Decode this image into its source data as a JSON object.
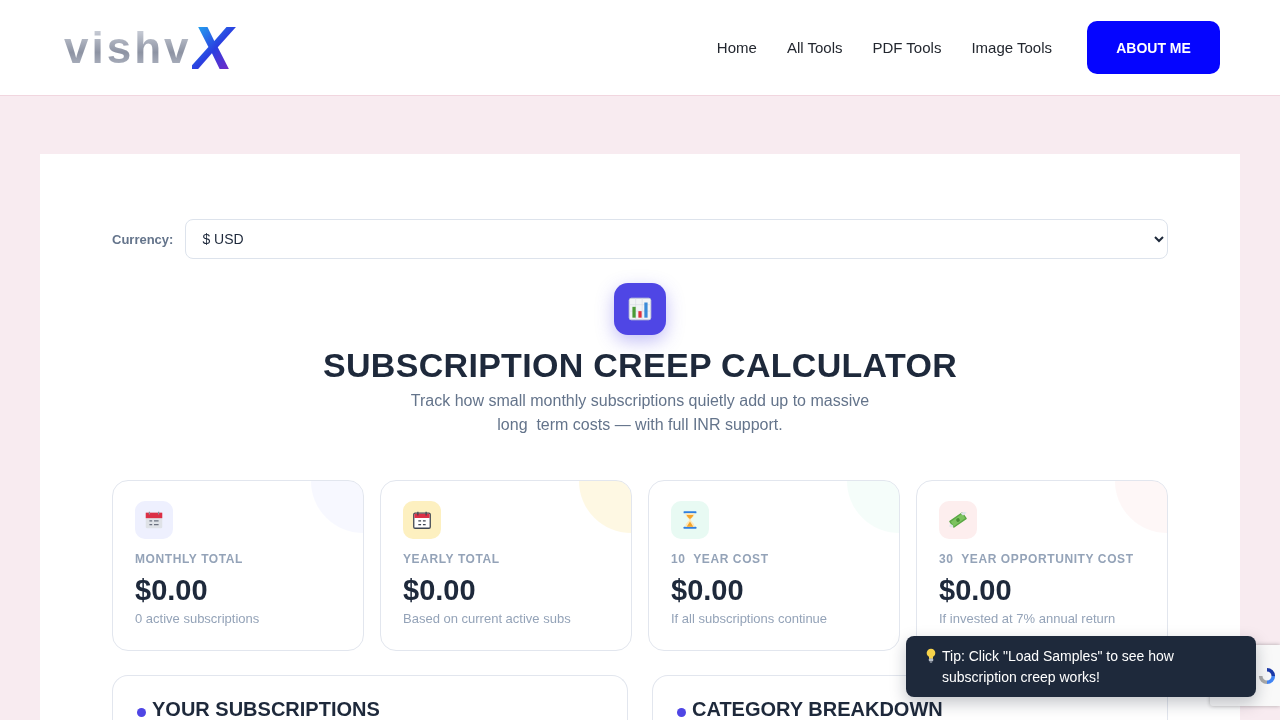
{
  "header": {
    "logo": {
      "text": "vishv",
      "mark": "X"
    },
    "nav": [
      {
        "label": "Home"
      },
      {
        "label": "All Tools"
      },
      {
        "label": "PDF Tools"
      },
      {
        "label": "Image Tools"
      }
    ],
    "cta": "ABOUT ME"
  },
  "currency": {
    "label": "Currency:",
    "value": "$ USD"
  },
  "hero": {
    "title": "SUBSCRIPTION CREEP CALCULATOR",
    "subtitle": "Track how small monthly subscriptions quietly add up to massive long  term costs — with full INR support."
  },
  "stats": [
    {
      "label": "MONTHLY TOTAL",
      "value": "$0.00",
      "caption": "0 active subscriptions",
      "color": "#eef0fe"
    },
    {
      "label": "YEARLY TOTAL",
      "value": "$0.00",
      "caption": "Based on current active subs",
      "color": "#fdf0c0"
    },
    {
      "label": "10  YEAR COST",
      "value": "$0.00",
      "caption": "If all subscriptions continue",
      "color": "#e8faf3"
    },
    {
      "label": "30  YEAR OPPORTUNITY COST",
      "value": "$0.00",
      "caption": "If invested at 7% annual return",
      "color": "#fdeeee"
    }
  ],
  "panels": [
    {
      "title": "YOUR SUBSCRIPTIONS"
    },
    {
      "title": "CATEGORY BREAKDOWN"
    }
  ],
  "toast": {
    "text": "Tip: Click \"Load Samples\" to see how subscription creep works!"
  }
}
